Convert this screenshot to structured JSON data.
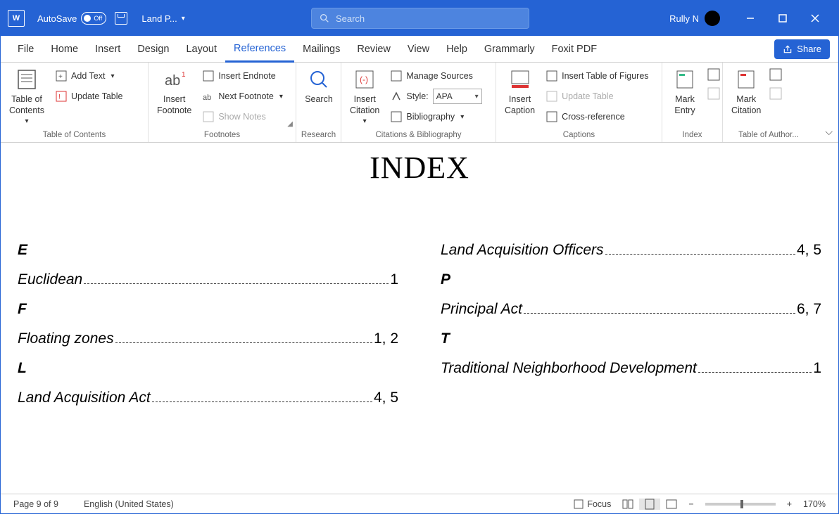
{
  "titlebar": {
    "autosave_label": "AutoSave",
    "autosave_state": "Off",
    "doc_title": "Land P...",
    "search_placeholder": "Search",
    "username": "Rully N"
  },
  "menu": {
    "tabs": [
      "File",
      "Home",
      "Insert",
      "Design",
      "Layout",
      "References",
      "Mailings",
      "Review",
      "View",
      "Help",
      "Grammarly",
      "Foxit PDF"
    ],
    "active": "References",
    "share": "Share"
  },
  "ribbon": {
    "toc": {
      "big": "Table of\nContents",
      "add_text": "Add Text",
      "update": "Update Table",
      "group": "Table of Contents"
    },
    "fn": {
      "big": "Insert\nFootnote",
      "endnote": "Insert Endnote",
      "next": "Next Footnote",
      "show": "Show Notes",
      "group": "Footnotes"
    },
    "research": {
      "big": "Search",
      "group": "Research"
    },
    "cite": {
      "big": "Insert\nCitation",
      "manage": "Manage Sources",
      "style_label": "Style:",
      "style_value": "APA",
      "bib": "Bibliography",
      "group": "Citations & Bibliography"
    },
    "caption": {
      "big": "Insert\nCaption",
      "figs": "Insert Table of Figures",
      "update": "Update Table",
      "cross": "Cross-reference",
      "group": "Captions"
    },
    "index": {
      "big": "Mark\nEntry",
      "group": "Index"
    },
    "auth": {
      "big": "Mark\nCitation",
      "group": "Table of Author..."
    }
  },
  "document": {
    "title": "INDEX",
    "left": [
      {
        "letter": "E"
      },
      {
        "term": "Euclidean",
        "pages": "1"
      },
      {
        "letter": "F"
      },
      {
        "term": "Floating zones",
        "pages": "1, 2"
      },
      {
        "letter": "L"
      },
      {
        "term": "Land Acquisition Act",
        "pages": "4, 5"
      }
    ],
    "right": [
      {
        "term": "Land Acquisition Officers",
        "pages": "4, 5"
      },
      {
        "letter": "P"
      },
      {
        "term": "Principal Act",
        "pages": "6, 7"
      },
      {
        "letter": "T"
      },
      {
        "term": "Traditional Neighborhood Development",
        "pages": "1"
      }
    ]
  },
  "statusbar": {
    "page": "Page 9 of 9",
    "lang": "English (United States)",
    "focus": "Focus",
    "zoom": "170%"
  }
}
